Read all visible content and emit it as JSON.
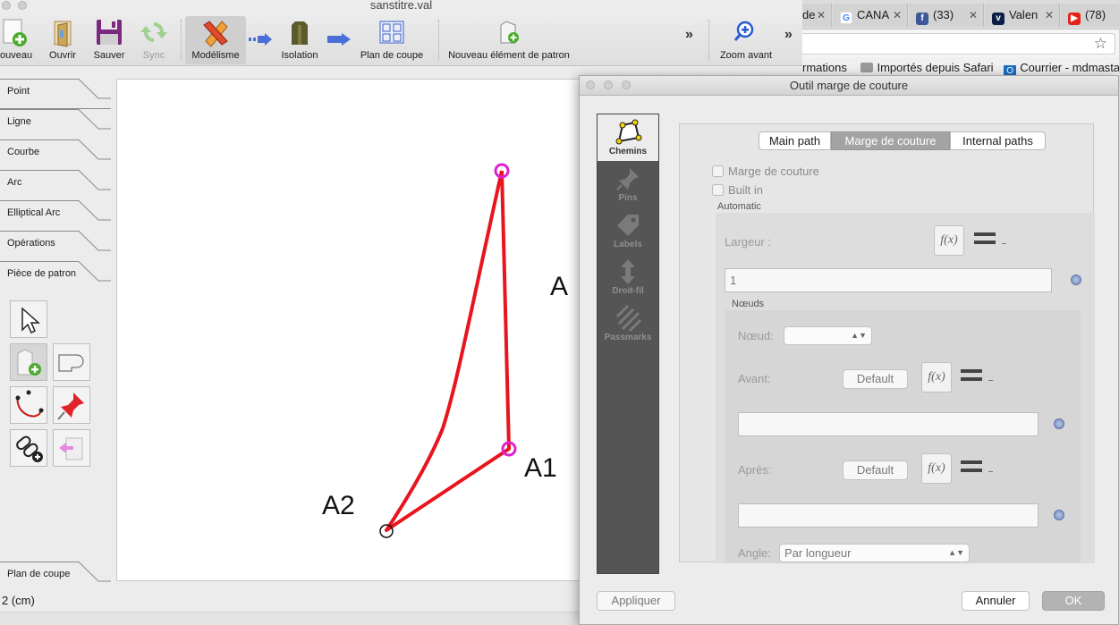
{
  "app": {
    "window_title": "sanstitre.val",
    "toolbar": {
      "new_label": "ouveau",
      "open_label": "Ouvrir",
      "save_label": "Sauver",
      "sync_label": "Sync",
      "drafting_label": "Modélisme",
      "details_label": "Isolation",
      "layout_label": "Plan de coupe",
      "new_piece_label": "Nouveau élément de patron",
      "zoom_in_label": "Zoom avant",
      "more_glyph": "»"
    },
    "tool_tabs": [
      {
        "label": "Point"
      },
      {
        "label": "Ligne"
      },
      {
        "label": "Courbe"
      },
      {
        "label": "Arc"
      },
      {
        "label": "Elliptical Arc"
      },
      {
        "label": "Opérations"
      },
      {
        "label": "Pièce de patron"
      }
    ],
    "bottom_tab": "Plan de coupe",
    "status_text": "2 (cm)",
    "canvas": {
      "labels": {
        "a": "A",
        "a1": "A1",
        "a2": "A2"
      },
      "path_color": "#e8141e",
      "selected_point_color": "#e020d0"
    }
  },
  "browser": {
    "tabs": [
      {
        "text": "de"
      },
      {
        "text": "CANA"
      },
      {
        "text": "(33)"
      },
      {
        "text": "Valen"
      },
      {
        "text": "(78)"
      }
    ],
    "bookmarks": {
      "item1": "rmations",
      "item2": "Importés depuis Safari",
      "item3": "Courrier - mdmasta."
    },
    "star_glyph": "☆"
  },
  "dialog": {
    "title": "Outil marge de couture",
    "nav": [
      {
        "label": "Chemins"
      },
      {
        "label": "Pins"
      },
      {
        "label": "Labels"
      },
      {
        "label": "Droit-fil"
      },
      {
        "label": "Passmarks"
      }
    ],
    "tabs": {
      "main_path": "Main path",
      "seam_allowance": "Marge de couture",
      "internal_paths": "Internal paths"
    },
    "seam_allowance_checkbox": "Marge de couture",
    "built_in_checkbox": "Built in",
    "automatic_group": "Automatic",
    "width_label": "Largeur :",
    "width_value": "1",
    "nodes_group": "Nœuds",
    "node_label": "Nœud:",
    "node_value": "",
    "before_label": "Avant:",
    "after_label": "Après:",
    "default_button": "Default",
    "before_value": "",
    "after_value": "",
    "angle_label": "Angle:",
    "angle_value": "Par longueur",
    "fx_label": "f(x)",
    "apply_button": "Appliquer",
    "cancel_button": "Annuler",
    "ok_button": "OK"
  }
}
